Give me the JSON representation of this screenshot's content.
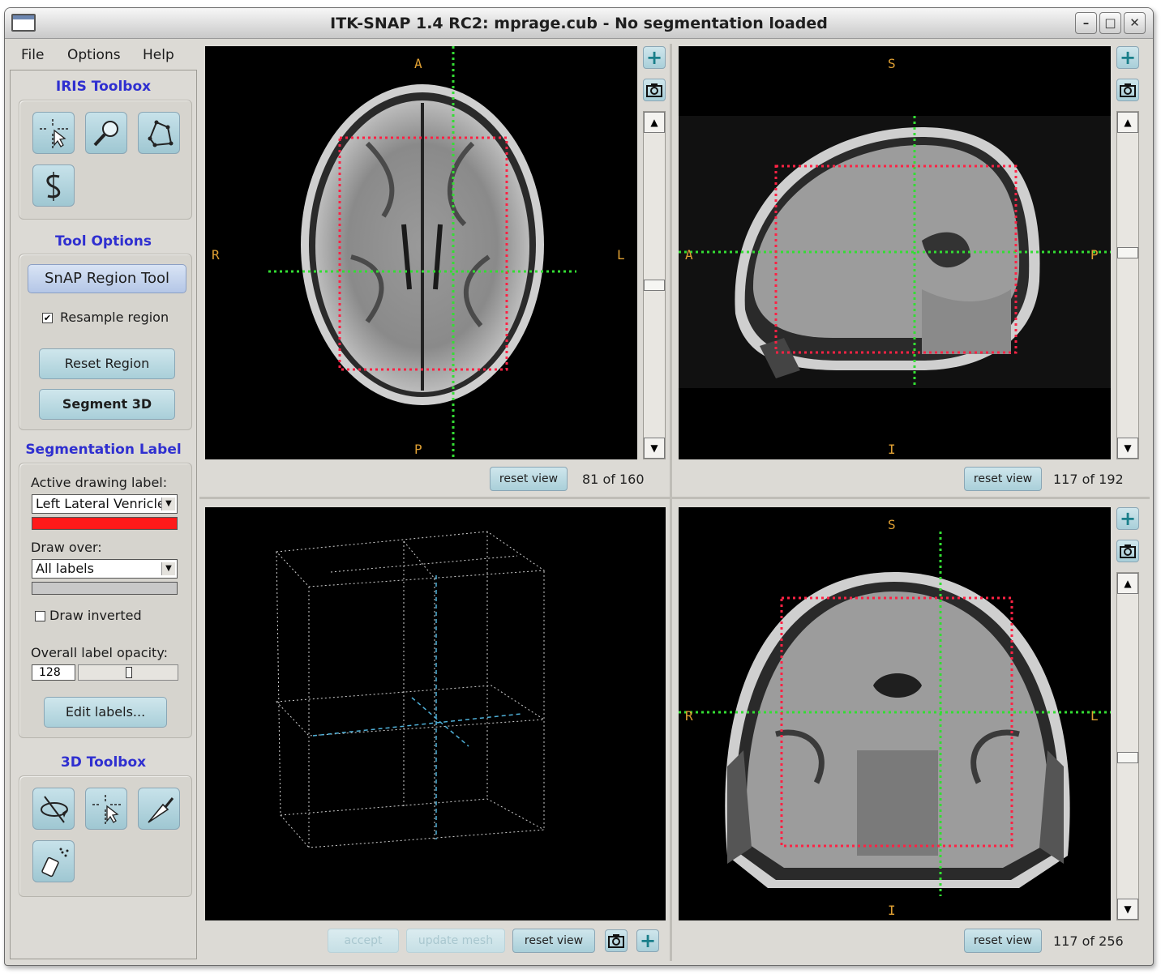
{
  "window": {
    "title": "ITK-SNAP 1.4 RC2: mprage.cub - No segmentation loaded"
  },
  "menu": {
    "file": "File",
    "options": "Options",
    "help": "Help"
  },
  "iris_toolbox": {
    "title": "IRIS Toolbox",
    "tools": [
      "crosshair-icon",
      "zoom-icon",
      "polygon-icon",
      "snake-icon"
    ]
  },
  "tool_options": {
    "title": "Tool Options",
    "snap_region_tool": "SnAP Region Tool",
    "resample_region": "Resample region",
    "resample_checked": true,
    "reset_region": "Reset Region",
    "segment_3d": "Segment 3D"
  },
  "segmentation_label": {
    "title": "Segmentation Label",
    "active_label_caption": "Active drawing label:",
    "active_label_value": "Left Lateral Venricle",
    "active_label_color": "#ff1a1a",
    "draw_over_caption": "Draw over:",
    "draw_over_value": "All labels",
    "draw_over_color": "#c8c8c8",
    "draw_inverted": "Draw inverted",
    "draw_inverted_checked": false,
    "opacity_caption": "Overall label opacity:",
    "opacity_value": "128",
    "edit_labels": "Edit labels..."
  },
  "toolbox_3d": {
    "title": "3D Toolbox",
    "tools": [
      "rotate-icon",
      "crosshair-3d-icon",
      "scalpel-icon",
      "spray-icon"
    ]
  },
  "views": {
    "axial": {
      "top": "A",
      "bottom": "P",
      "left": "R",
      "right": "L",
      "reset": "reset view",
      "slice": "81 of 160",
      "slider_fraction": 0.5
    },
    "sagittal": {
      "top": "S",
      "bottom": "I",
      "left": "A",
      "right": "P",
      "reset": "reset view",
      "slice": "117 of 192",
      "slider_fraction": 0.39
    },
    "coronal": {
      "top": "S",
      "bottom": "I",
      "left": "R",
      "right": "L",
      "reset": "reset view",
      "slice": "117 of 256",
      "slider_fraction": 0.54
    },
    "three_d": {
      "accept": "accept",
      "update_mesh": "update mesh",
      "reset": "reset view"
    }
  },
  "colors": {
    "crosshair": "#33dd33",
    "roi": "#ff2244",
    "orientation": "#e0a033",
    "accent_title": "#2f2fd0",
    "button": "#a9cfd9"
  }
}
